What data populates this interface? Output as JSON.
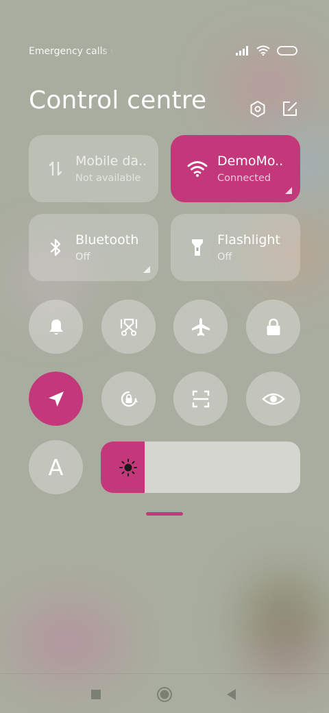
{
  "status_bar": {
    "carrier_text": "Emergency calls only",
    "icons": [
      "signal-icon",
      "wifi-icon",
      "battery-icon"
    ]
  },
  "header": {
    "title": "Control centre",
    "icons": [
      "settings-icon",
      "edit-icon"
    ]
  },
  "tiles": [
    {
      "label": "Mobile da..",
      "sub": "Not available",
      "icon": "mobile-data-icon",
      "active": false
    },
    {
      "label": "DemoMo..",
      "sub": "Connected",
      "icon": "wifi-icon",
      "active": true
    },
    {
      "label": "Bluetooth",
      "sub": "Off",
      "icon": "bluetooth-icon",
      "active": false
    },
    {
      "label": "Flashlight",
      "sub": "Off",
      "icon": "flashlight-icon",
      "active": false
    }
  ],
  "toggles": [
    {
      "name": "bell-icon",
      "active": false
    },
    {
      "name": "screenshot-icon",
      "active": false
    },
    {
      "name": "airplane-icon",
      "active": false
    },
    {
      "name": "lock-icon",
      "active": false
    },
    {
      "name": "location-icon",
      "active": true
    },
    {
      "name": "auto-rotate-icon",
      "active": false
    },
    {
      "name": "scan-icon",
      "active": false
    },
    {
      "name": "eye-icon",
      "active": false
    }
  ],
  "font_button": {
    "label": "A"
  },
  "brightness": {
    "level": 0.22,
    "icon": "brightness-icon"
  },
  "colors": {
    "accent": "#c2387a",
    "background": "#a9ad9f"
  },
  "nav": [
    "recents-icon",
    "home-icon",
    "back-icon"
  ]
}
